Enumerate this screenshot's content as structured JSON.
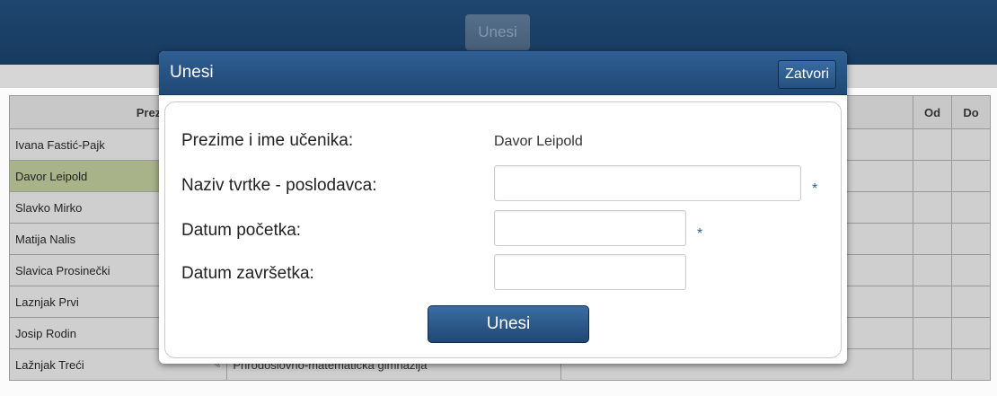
{
  "topbar": {
    "button_label": "Unesi"
  },
  "table": {
    "headers": {
      "name": "Prezime i ime u",
      "od": "Od",
      "do": "Do"
    },
    "rows": [
      {
        "name": "Ivana Fastić-Pajk",
        "subject": ""
      },
      {
        "name": "Davor Leipold",
        "subject": ""
      },
      {
        "name": "Slavko Mirko",
        "subject": ""
      },
      {
        "name": "Matija Nalis",
        "subject": ""
      },
      {
        "name": "Slavica Prosinečki",
        "subject": ""
      },
      {
        "name": "Laznjak Prvi",
        "subject": ""
      },
      {
        "name": "Josip Rodin",
        "subject": ""
      },
      {
        "name": "Lažnjak Treći",
        "subject": "Prirodoslovno-matematička gimnazija"
      }
    ]
  },
  "dialog": {
    "title": "Unesi",
    "close_label": "Zatvori",
    "fields": {
      "student_label": "Prezime i ime učenika:",
      "student_value": "Davor Leipold",
      "company_label": "Naziv tvrtke - poslodavca:",
      "start_label": "Datum početka:",
      "end_label": "Datum završetka:",
      "required_mark": "*"
    },
    "submit_label": "Unesi"
  }
}
